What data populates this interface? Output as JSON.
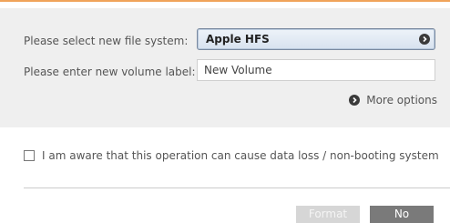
{
  "file_system": {
    "label": "Please select new file system:",
    "selected": "Apple HFS"
  },
  "volume": {
    "label": "Please enter new volume label:",
    "value": "New Volume"
  },
  "more_options_label": "More options",
  "confirmation": {
    "label": "I am aware that this operation can cause data loss / non-booting system",
    "checked": false
  },
  "buttons": {
    "format_label": "Format",
    "no_label": "No"
  },
  "colors": {
    "accent_line": "#f0a35a",
    "panel_bg": "#efefef",
    "format_disabled": "#d6d6d6",
    "no_button": "#7a7a7a"
  }
}
